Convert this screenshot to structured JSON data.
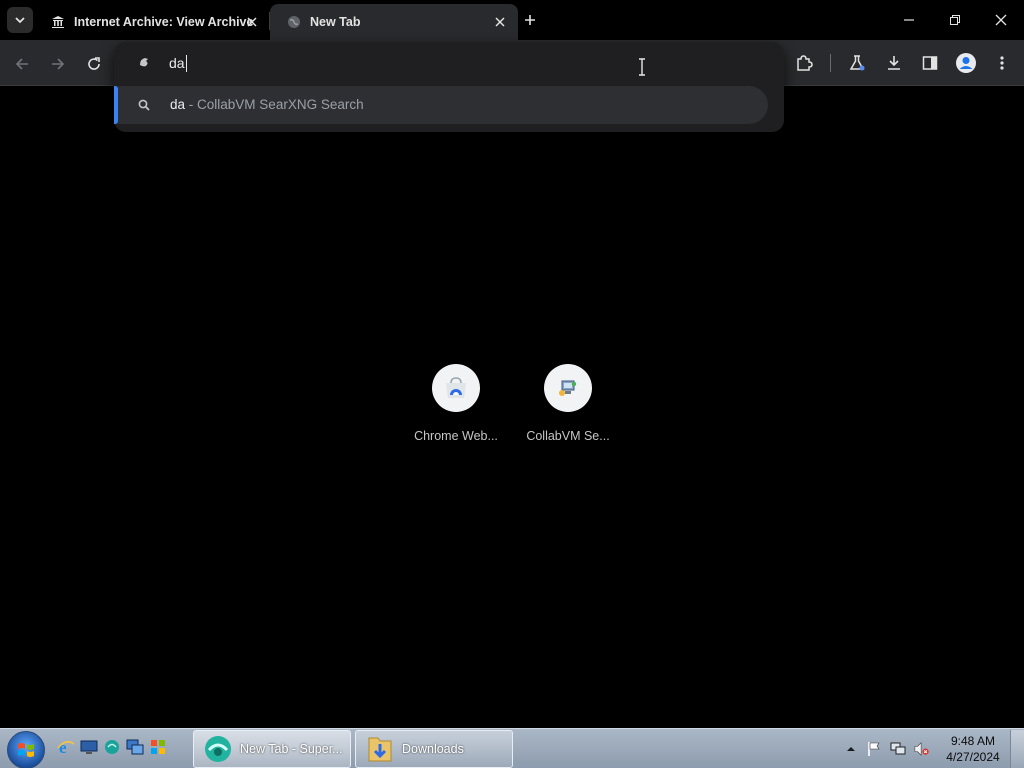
{
  "browser": {
    "tabs": [
      {
        "title": "Internet Archive: View Archive",
        "icon": "bank-icon",
        "active": false
      },
      {
        "title": "New Tab",
        "icon": "globe-icon",
        "active": true
      }
    ]
  },
  "omnibox": {
    "typed_text": "da",
    "suggestion": {
      "query": "da",
      "separator_and_engine": " - CollabVM SearXNG Search"
    },
    "highlight_color": "#3b82f6"
  },
  "shortcuts": [
    {
      "label": "Chrome Web...",
      "icon": "chrome-web-store-icon"
    },
    {
      "label": "CollabVM Se...",
      "icon": "collabvm-icon"
    }
  ],
  "taskbar": {
    "tasks": [
      {
        "label": "New Tab - Super...",
        "icon": "browser-icon"
      },
      {
        "label": "Downloads",
        "icon": "folder-icon"
      }
    ],
    "clock": {
      "time": "9:48 AM",
      "date": "4/27/2024"
    }
  },
  "colors": {
    "page_bg": "#000000",
    "toolbar_bg": "#292a2d",
    "omnibox_bg": "#1f1f22"
  }
}
